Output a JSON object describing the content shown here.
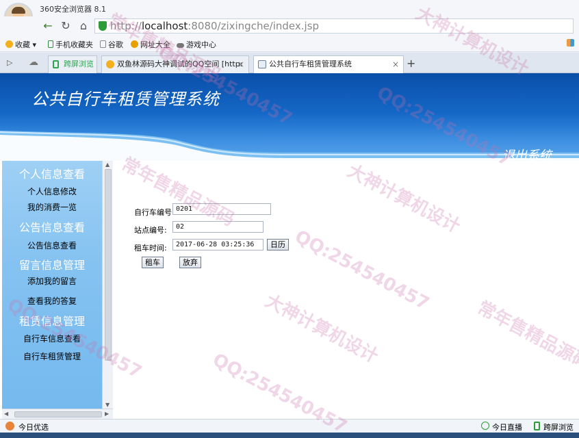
{
  "browser": {
    "title": "360安全浏览器 8.1",
    "url_host": "localhost",
    "url_rest": ":8080/zixingche/index.jsp",
    "url_scheme": "http://"
  },
  "bookmarks": [
    {
      "label": "收藏",
      "icon": "star-icon",
      "color": "#f2b01e"
    },
    {
      "label": "手机收藏夹",
      "icon": "phone-icon",
      "color": "#2e8b3a"
    },
    {
      "label": "谷歌",
      "icon": "page-icon",
      "color": "#888888"
    },
    {
      "label": "网址大全",
      "icon": "globe-icon",
      "color": "#e8a000"
    },
    {
      "label": "游戏中心",
      "icon": "gamepad-icon",
      "color": "#666666"
    }
  ],
  "tabs": [
    {
      "label": "跨屏浏览",
      "icon_color": "#2da44e"
    },
    {
      "label": "双鱼林源码大神调试的QQ空间 [http:",
      "icon_color": "#f2b01e"
    },
    {
      "label": "公共自行车租赁管理系统",
      "icon_color": "#6b7f99"
    }
  ],
  "banner": {
    "title": "公共自行车租赁管理系统",
    "logout": "退出系统"
  },
  "sidebar": {
    "sections": [
      {
        "heading": "个人信息查看",
        "items": [
          "个人信息修改",
          "我的消费一览"
        ]
      },
      {
        "heading": "公告信息查看",
        "items": [
          "公告信息查看"
        ]
      },
      {
        "heading": "留言信息管理",
        "items": [
          "添加我的留言",
          "查看我的答复"
        ]
      },
      {
        "heading": "租赁信息管理",
        "items": [
          "自行车信息查看",
          "自行车租赁管理"
        ]
      }
    ]
  },
  "form": {
    "bike_no_label": "自行车编号:",
    "bike_no_value": "0201",
    "station_label": "站点编号:",
    "station_value": "02",
    "time_label": "租车时间:",
    "time_value": "2017-06-28 03:25:36",
    "calendar_button": "日历",
    "rent_button": "租车",
    "cancel_button": "放弃"
  },
  "statusbar": {
    "left": "今日优选",
    "live": "今日直播",
    "cross": "跨屏浏览"
  },
  "watermarks": [
    "大神计算机设计",
    "QQ:254540457",
    "常年售精品源码"
  ]
}
